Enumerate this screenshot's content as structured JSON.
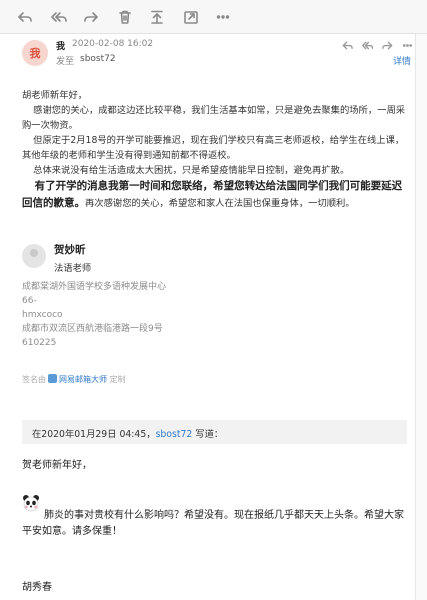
{
  "toolbar": {
    "buttons": [
      "reply-icon",
      "reply-all-icon",
      "forward-icon",
      "delete-icon",
      "move-up-icon",
      "open-external-icon",
      "more-icon"
    ]
  },
  "header": {
    "avatar_text": "我",
    "sender": "我",
    "date": "2020-02-08 16:02",
    "to_label": "发至",
    "to_value": "sbost72",
    "details_label": "详情"
  },
  "body": {
    "greeting": "胡老师新年好，",
    "p1": "感谢您的关心，成都这边还比较平稳，我们生活基本如常，只是避免去聚集的场所，一周采购一次物资。",
    "p2": "但原定于2月18号的开学可能要推迟，现在我们学校只有高三老师返校，给学生在线上课，其他年级的老师和学生没有得到通知前都不得返校。",
    "p3": "总体来说没有给生活造成太大困扰，只是希望疫情能早日控制，避免再扩散。",
    "bold": "有了开学的消息我第一时间和您联络，希望您转达给法国同学们我们可能要延迟回信的歉意。",
    "tail": "再次感谢您的关心，希望您和家人在法国也保重身体，一切顺利。"
  },
  "signature": {
    "name": "贺妙昕",
    "title": "法语老师",
    "lines": [
      "成都棠湖外国语学校多语种发展中心",
      "66-",
      "hmxcoco",
      "成都市双流区西航港临港路一段9号",
      "610225"
    ]
  },
  "tag": {
    "prefix": "签名由",
    "link": "网易邮箱大师",
    "suffix": "定制"
  },
  "quote_header": {
    "prefix": "在2020年01月29日 04:45，",
    "address": "sbost72",
    "suffix": " 写道："
  },
  "quote": {
    "greeting": "贺老师新年好，",
    "text": "肺炎的事对贵校有什么影响吗？希望没有。现在报纸几乎都天天上头条。希望大家平安如意。请多保重！",
    "sign": "胡秀春"
  }
}
